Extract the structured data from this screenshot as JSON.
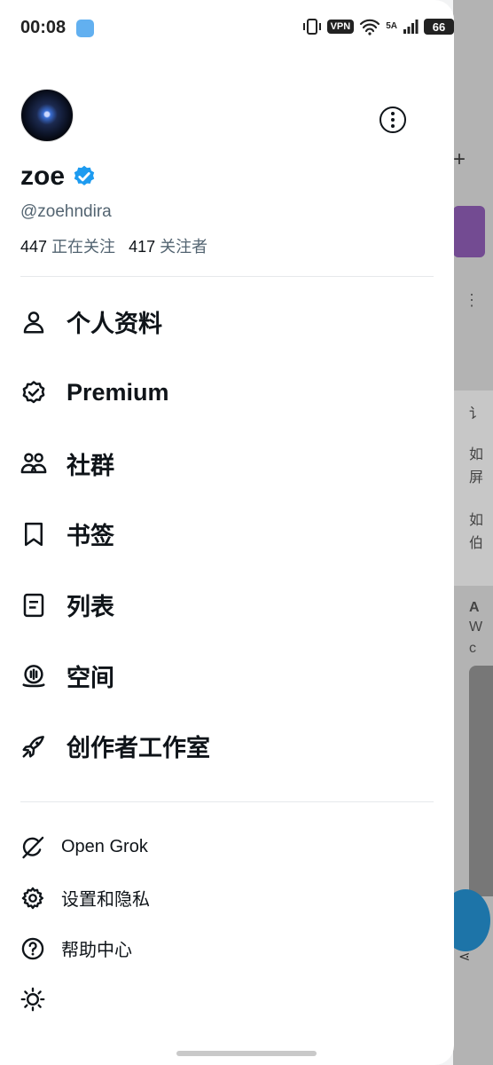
{
  "status_bar": {
    "time": "00:08",
    "vpn": "VPN",
    "net": "5A",
    "battery": "66"
  },
  "profile": {
    "name": "zoe",
    "handle": "@zoehndira",
    "following_count": "447",
    "following_label": "正在关注",
    "followers_count": "417",
    "followers_label": "关注者"
  },
  "menu": {
    "profile": "个人资料",
    "premium": "Premium",
    "communities": "社群",
    "bookmarks": "书签",
    "lists": "列表",
    "spaces": "空间",
    "creator_studio": "创作者工作室"
  },
  "secondary": {
    "grok": "Open Grok",
    "settings": "设置和隐私",
    "help": "帮助中心"
  },
  "background": {
    "plus": "+",
    "snippets": [
      "讠",
      "如",
      "屏",
      "如",
      "伯",
      "A",
      "W",
      "c"
    ]
  },
  "colors": {
    "verified": "#1d9bf0",
    "text": "#0f1419",
    "muted": "#536471"
  }
}
